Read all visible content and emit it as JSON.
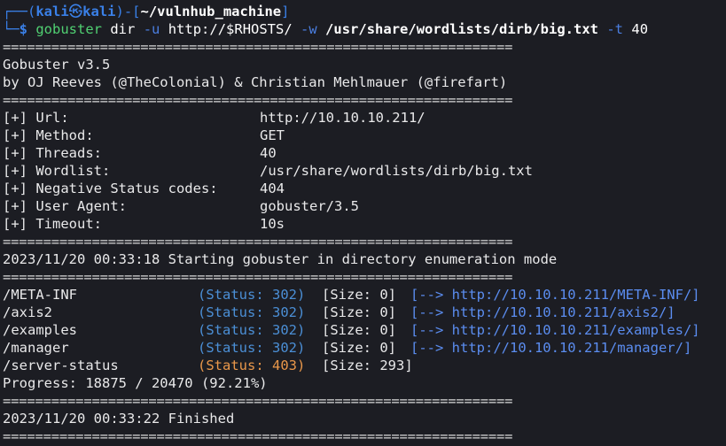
{
  "prompt": {
    "bracket_open": "┌──(",
    "user": "kali",
    "at": "㉿",
    "host": "kali",
    "bracket_mid": ")-[",
    "cwd": "~/vulnhub_machine",
    "bracket_close": "]",
    "arrow": "└─$",
    "cmd": "gobuster",
    "arg1": "dir",
    "flag_u": "-u",
    "url": "http://$RHOSTS/",
    "flag_w": "-w",
    "wordlist": "/usr/share/wordlists/dirb/big.txt",
    "flag_t": "-t",
    "threads": "40"
  },
  "separator": "===============================================================",
  "banner": {
    "title": "Gobuster v3.5",
    "authors": "by OJ Reeves (@TheColonial) & Christian Mehlmauer (@firefart)"
  },
  "config": [
    {
      "key": "[+] Url:",
      "value": "http://10.10.10.211/"
    },
    {
      "key": "[+] Method:",
      "value": "GET"
    },
    {
      "key": "[+] Threads:",
      "value": "40"
    },
    {
      "key": "[+] Wordlist:",
      "value": "/usr/share/wordlists/dirb/big.txt"
    },
    {
      "key": "[+] Negative Status codes:",
      "value": "404"
    },
    {
      "key": "[+] User Agent:",
      "value": "gobuster/3.5"
    },
    {
      "key": "[+] Timeout:",
      "value": "10s"
    }
  ],
  "start_msg": "2023/11/20 00:33:18 Starting gobuster in directory enumeration mode",
  "results": [
    {
      "path": "/META-INF",
      "status": "(Status: 302)",
      "size": "[Size: 0]",
      "link": "[--> http://10.10.10.211/META-INF/]",
      "code": "302"
    },
    {
      "path": "/axis2",
      "status": "(Status: 302)",
      "size": "[Size: 0]",
      "link": "[--> http://10.10.10.211/axis2/]",
      "code": "302"
    },
    {
      "path": "/examples",
      "status": "(Status: 302)",
      "size": "[Size: 0]",
      "link": "[--> http://10.10.10.211/examples/]",
      "code": "302"
    },
    {
      "path": "/manager",
      "status": "(Status: 302)",
      "size": "[Size: 0]",
      "link": "[--> http://10.10.10.211/manager/]",
      "code": "302"
    },
    {
      "path": "/server-status",
      "status": "(Status: 403)",
      "size": "[Size: 293]",
      "link": "",
      "code": "403"
    }
  ],
  "progress": "Progress: 18875 / 20470 (92.21%)",
  "finish_msg": "2023/11/20 00:33:22 Finished",
  "colors": {
    "background": "#1c1d23",
    "prompt_blue": "#3a80e8",
    "status_302": "#4b8fd6",
    "status_403": "#e9974a",
    "link": "#5b8df0"
  }
}
